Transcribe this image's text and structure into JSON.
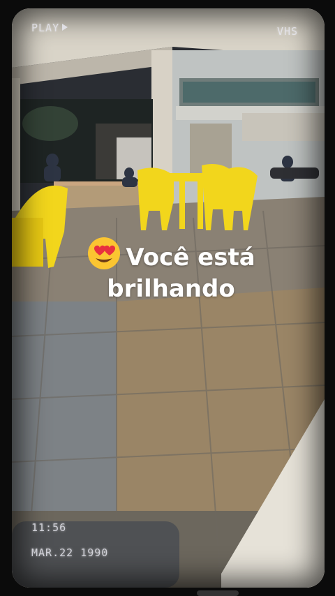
{
  "overlay": {
    "play_label": "PLAY",
    "format_label": "VHS",
    "time": "11:56",
    "date": "MAR.22 1990"
  },
  "caption": {
    "emoji": "heart-eyes-emoji",
    "line1": "Você está",
    "line2": "brilhando"
  },
  "colors": {
    "caption_text": "#ffffff",
    "chair_yellow": "#f2d61c",
    "floor_tile": "#8a7f70",
    "frame": "#0b0b0b"
  }
}
